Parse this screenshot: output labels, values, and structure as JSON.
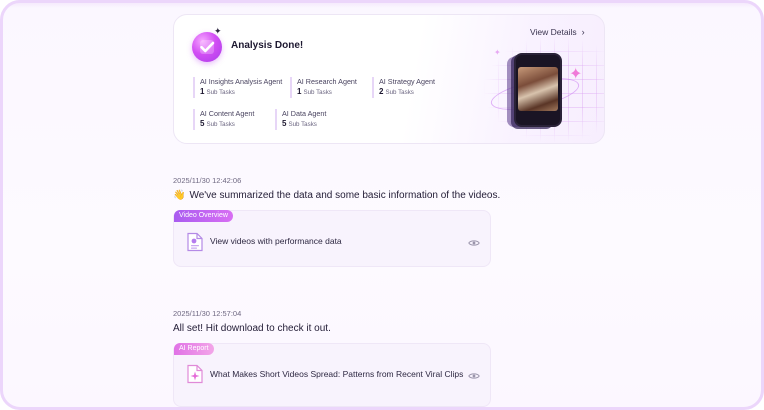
{
  "analysis": {
    "title": "Analysis Done!",
    "view_details_label": "View Details",
    "agents": [
      {
        "name": "AI Insights Analysis Agent",
        "count": "1",
        "unit": "Sub Tasks"
      },
      {
        "name": "AI Research Agent",
        "count": "1",
        "unit": "Sub Tasks"
      },
      {
        "name": "AI Strategy Agent",
        "count": "2",
        "unit": "Sub Tasks"
      },
      {
        "name": "AI Content Agent",
        "count": "5",
        "unit": "Sub Tasks"
      },
      {
        "name": "AI Data Agent",
        "count": "5",
        "unit": "Sub Tasks"
      }
    ]
  },
  "messages": [
    {
      "timestamp": "2025/11/30 12:42:06",
      "emoji": "👋",
      "text": "We've summarized the data and some basic information of the videos.",
      "card": {
        "tag": "Video Overview",
        "title": "View videos with performance data"
      }
    },
    {
      "timestamp": "2025/11/30 12:57:04",
      "text": "All set! Hit download to check it out.",
      "card": {
        "tag": "AI Report",
        "title": "What Makes Short Videos Spread: Patterns from Recent Viral Clips"
      }
    }
  ],
  "icons": {
    "badge": "check-badge-icon",
    "chevron": "chevron-right-icon",
    "document": "document-icon",
    "eye": "eye-icon"
  },
  "colors": {
    "accent": "#c64cf0",
    "tag_purple": "#a95cf0",
    "tag_pink": "#e072e6",
    "frame_border": "#ecd6fb"
  }
}
